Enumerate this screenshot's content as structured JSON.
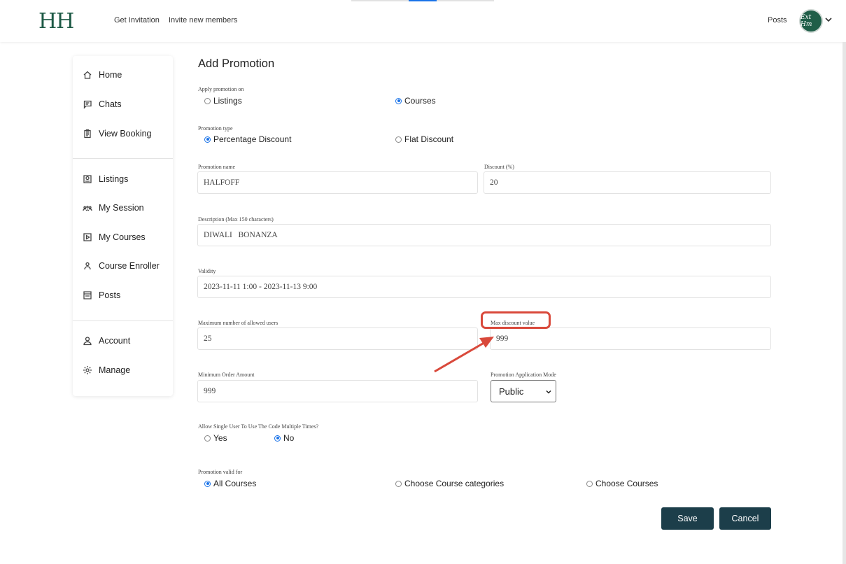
{
  "header": {
    "logo": "HH",
    "nav": [
      "Get Invitation",
      "Invite new members"
    ],
    "posts": "Posts",
    "avatar_text": "Ext Hm"
  },
  "sidebar": {
    "group1": [
      {
        "label": "Home",
        "icon": "home-icon"
      },
      {
        "label": "Chats",
        "icon": "chat-icon"
      },
      {
        "label": "View Booking",
        "icon": "clipboard-icon"
      }
    ],
    "group2": [
      {
        "label": "Listings",
        "icon": "listings-icon"
      },
      {
        "label": "My Session",
        "icon": "group-icon"
      },
      {
        "label": "My Courses",
        "icon": "play-icon"
      },
      {
        "label": "Course Enroller",
        "icon": "user-icon"
      },
      {
        "label": "Posts",
        "icon": "posts-icon"
      }
    ],
    "group3": [
      {
        "label": "Account",
        "icon": "account-icon"
      },
      {
        "label": "Manage",
        "icon": "gear-icon"
      }
    ]
  },
  "form": {
    "title": "Add Promotion",
    "apply_on": {
      "label": "Apply promotion on",
      "options": [
        "Listings",
        "Courses"
      ],
      "selected": "Courses"
    },
    "type": {
      "label": "Promotion type",
      "options": [
        "Percentage Discount",
        "Flat Discount"
      ],
      "selected": "Percentage Discount"
    },
    "name": {
      "label": "Promotion name",
      "value": "HALFOFF"
    },
    "discount": {
      "label": "Discount (%)",
      "value": "20"
    },
    "description": {
      "label": "Description (Max 150 characters)",
      "value": "DIWALI   BONANZA"
    },
    "validity": {
      "label": "Validity",
      "value": "2023-11-11 1:00 - 2023-11-13 9:00"
    },
    "max_users": {
      "label": "Maximum number of allowed users",
      "value": "25"
    },
    "max_discount": {
      "label": "Max discount value",
      "value": "999"
    },
    "min_order": {
      "label": "Minimum Order Amount",
      "value": "999"
    },
    "mode": {
      "label": "Promotion Application Mode",
      "value": "Public"
    },
    "multi_use": {
      "label": "Allow Single User To Use The Code Multiple Times?",
      "options": [
        "Yes",
        "No"
      ],
      "selected": "No"
    },
    "valid_for": {
      "label": "Promotion valid for",
      "options": [
        "All Courses",
        "Choose Course categories",
        "Choose Courses"
      ],
      "selected": "All Courses"
    },
    "save": "Save",
    "cancel": "Cancel"
  },
  "colors": {
    "brand": "#1e5a46",
    "button": "#1c3e4a",
    "highlight": "#d9493b",
    "radio": "#1a73e8"
  }
}
